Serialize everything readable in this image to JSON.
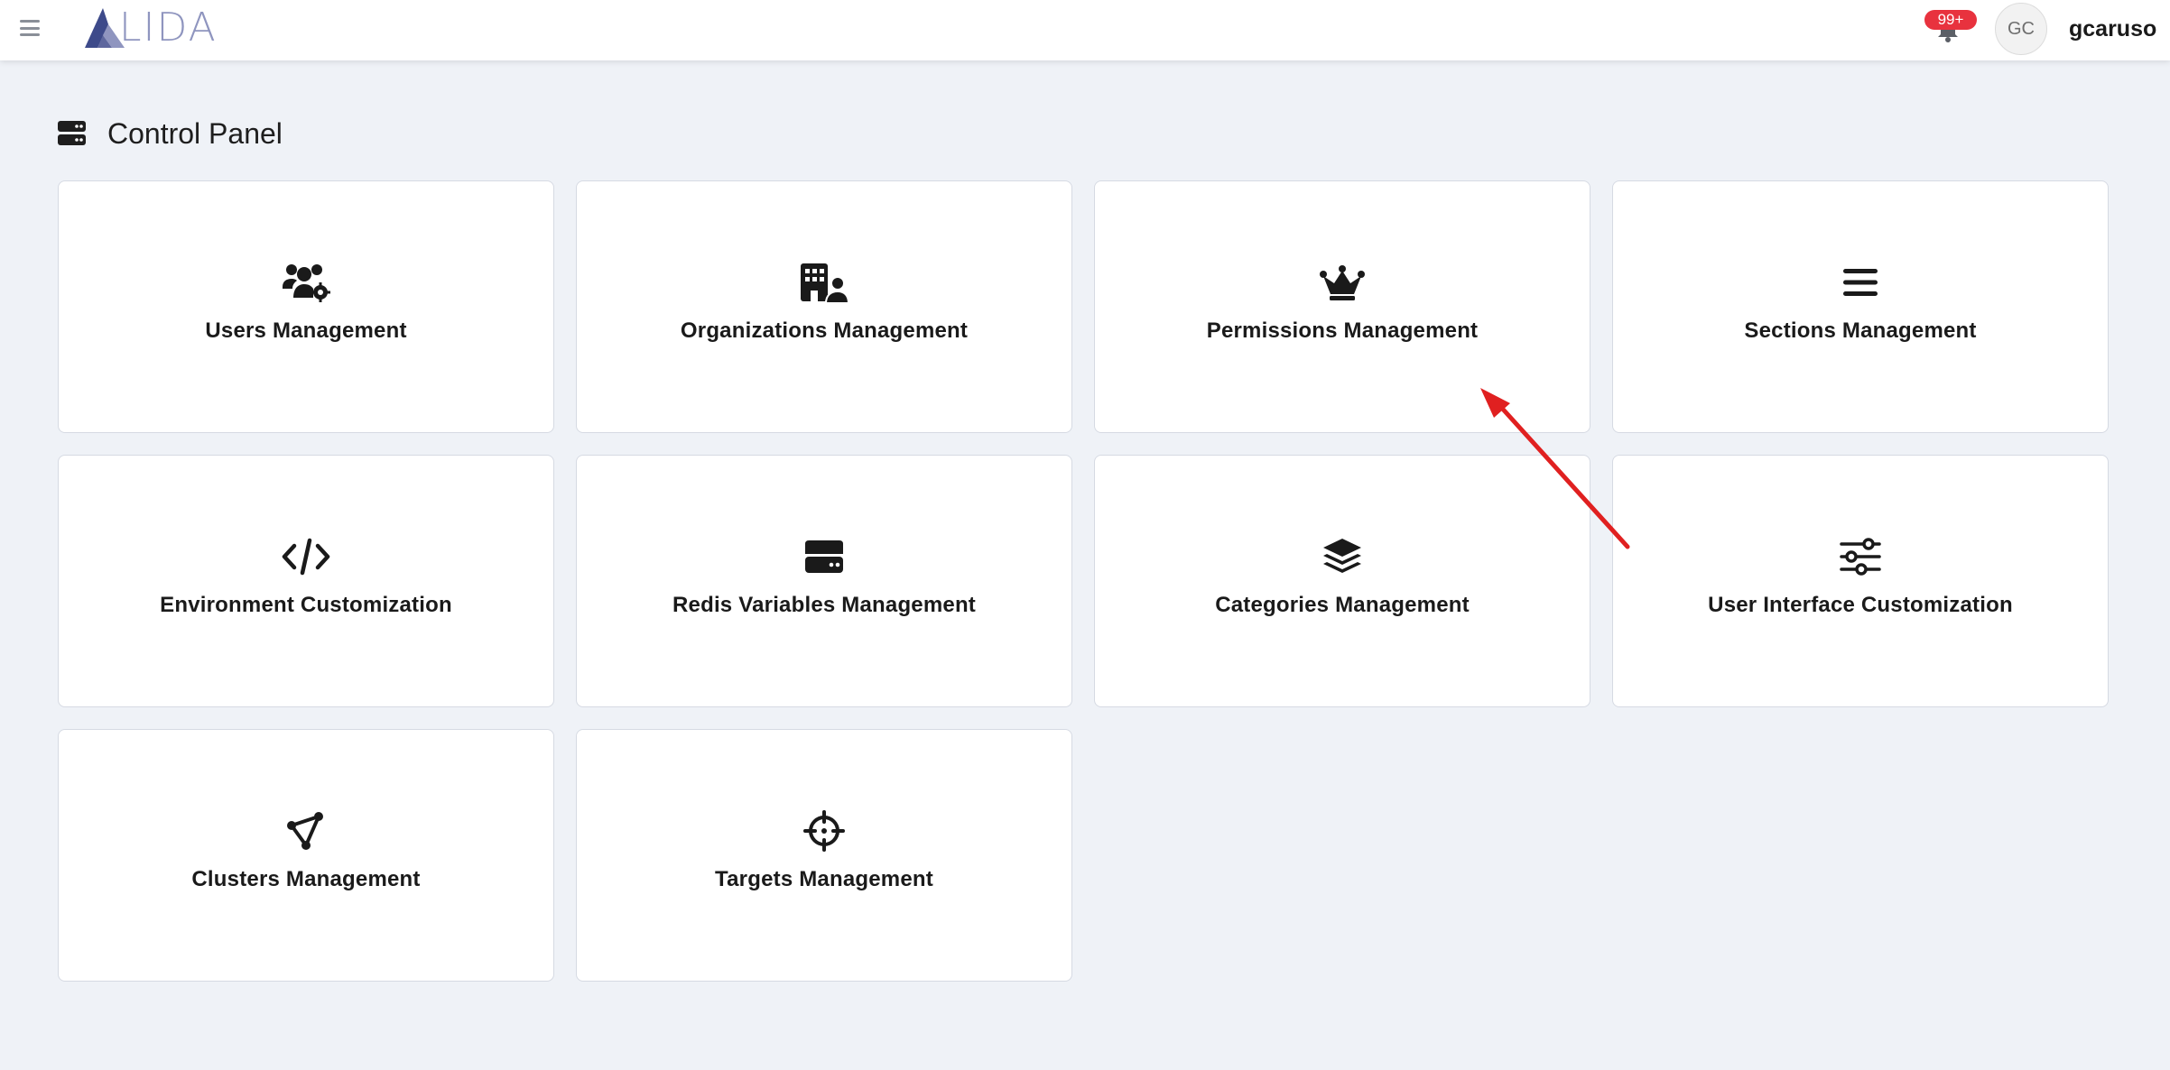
{
  "header": {
    "logo_text": "LIDA",
    "notification_badge": "99+",
    "avatar_initials": "GC",
    "username": "gcaruso"
  },
  "page": {
    "title": "Control Panel"
  },
  "cards": [
    {
      "label": "Users Management",
      "icon": "users-cog-icon"
    },
    {
      "label": "Organizations Management",
      "icon": "building-user-icon"
    },
    {
      "label": "Permissions Management",
      "icon": "crown-icon"
    },
    {
      "label": "Sections Management",
      "icon": "bars-icon"
    },
    {
      "label": "Environment Customization",
      "icon": "code-icon"
    },
    {
      "label": "Redis Variables Management",
      "icon": "hard-drive-icon"
    },
    {
      "label": "Categories Management",
      "icon": "layer-group-icon"
    },
    {
      "label": "User Interface Customization",
      "icon": "sliders-icon"
    },
    {
      "label": "Clusters Management",
      "icon": "nodes-icon"
    },
    {
      "label": "Targets Management",
      "icon": "crosshairs-icon"
    }
  ],
  "colors": {
    "background": "#eff2f7",
    "card": "#ffffff",
    "badge": "#e8323e",
    "logo": "#8f95bf",
    "annotation_arrow": "#e02020"
  }
}
